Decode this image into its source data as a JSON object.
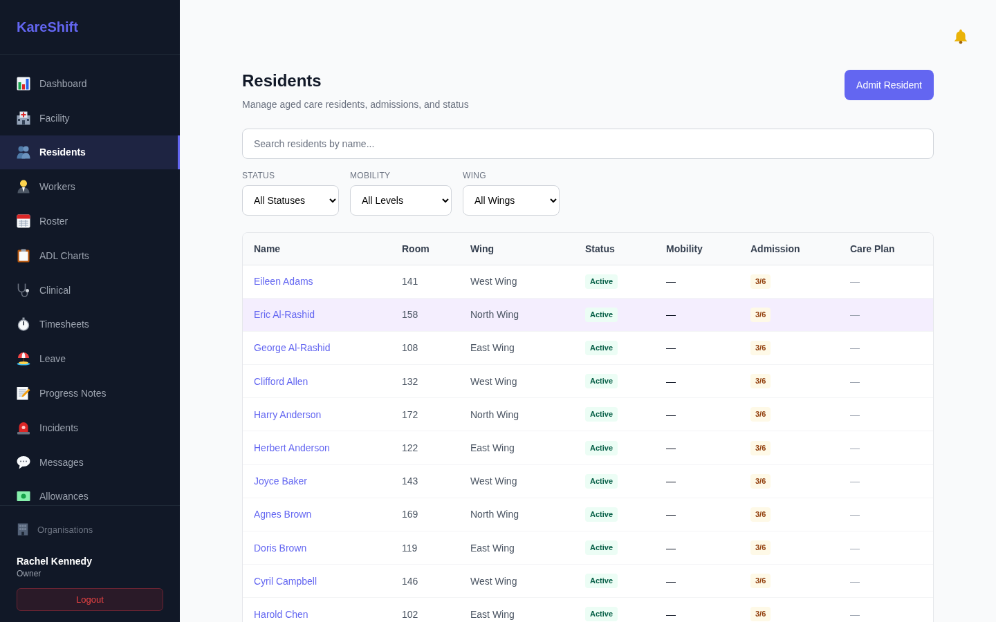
{
  "sidebar": {
    "logo": "KareShift",
    "nav_items": [
      {
        "label": "Dashboard",
        "selected": false
      },
      {
        "label": "Facility",
        "selected": false
      },
      {
        "label": "Residents",
        "selected": true
      },
      {
        "label": "Workers",
        "selected": false
      },
      {
        "label": "Roster",
        "selected": false
      },
      {
        "label": "ADL Charts",
        "selected": false
      },
      {
        "label": "Clinical",
        "selected": false
      },
      {
        "label": "Timesheets",
        "selected": false
      },
      {
        "label": "Leave",
        "selected": false
      },
      {
        "label": "Progress Notes",
        "selected": false
      },
      {
        "label": "Incidents",
        "selected": false
      },
      {
        "label": "Messages",
        "selected": false
      },
      {
        "label": "Allowances",
        "selected": false
      }
    ],
    "organisations_link": "Organisations",
    "user": {
      "name": "Rachel Kennedy",
      "role": "Owner"
    },
    "logout_button": "Logout"
  },
  "header": {
    "title": "Residents",
    "subtitle": "Manage aged care residents, admissions, and status",
    "primary_button": "Admit Resident"
  },
  "search": {
    "placeholder": "Search residents by name..."
  },
  "filters": [
    {
      "label": "STATUS",
      "value": "All Statuses"
    },
    {
      "label": "MOBILITY",
      "value": "All Levels"
    },
    {
      "label": "WING",
      "value": "All Wings"
    }
  ],
  "table": {
    "columns": [
      "Name",
      "Room",
      "Wing",
      "Status",
      "Mobility",
      "Admission",
      "Care Plan"
    ],
    "rows": [
      {
        "name": "Eileen Adams",
        "room": "141",
        "wing": "West Wing",
        "status": "Active",
        "mobility": "—",
        "admission": "3/6",
        "care_plan": "—",
        "hovered": false
      },
      {
        "name": "Eric Al-Rashid",
        "room": "158",
        "wing": "North Wing",
        "status": "Active",
        "mobility": "—",
        "admission": "3/6",
        "care_plan": "—",
        "hovered": true
      },
      {
        "name": "George Al-Rashid",
        "room": "108",
        "wing": "East Wing",
        "status": "Active",
        "mobility": "—",
        "admission": "3/6",
        "care_plan": "—",
        "hovered": false
      },
      {
        "name": "Clifford Allen",
        "room": "132",
        "wing": "West Wing",
        "status": "Active",
        "mobility": "—",
        "admission": "3/6",
        "care_plan": "—",
        "hovered": false
      },
      {
        "name": "Harry Anderson",
        "room": "172",
        "wing": "North Wing",
        "status": "Active",
        "mobility": "—",
        "admission": "3/6",
        "care_plan": "—",
        "hovered": false
      },
      {
        "name": "Herbert Anderson",
        "room": "122",
        "wing": "East Wing",
        "status": "Active",
        "mobility": "—",
        "admission": "3/6",
        "care_plan": "—",
        "hovered": false
      },
      {
        "name": "Joyce Baker",
        "room": "143",
        "wing": "West Wing",
        "status": "Active",
        "mobility": "—",
        "admission": "3/6",
        "care_plan": "—",
        "hovered": false
      },
      {
        "name": "Agnes Brown",
        "room": "169",
        "wing": "North Wing",
        "status": "Active",
        "mobility": "—",
        "admission": "3/6",
        "care_plan": "—",
        "hovered": false
      },
      {
        "name": "Doris Brown",
        "room": "119",
        "wing": "East Wing",
        "status": "Active",
        "mobility": "—",
        "admission": "3/6",
        "care_plan": "—",
        "hovered": false
      },
      {
        "name": "Cyril Campbell",
        "room": "146",
        "wing": "West Wing",
        "status": "Active",
        "mobility": "—",
        "admission": "3/6",
        "care_plan": "—",
        "hovered": false
      },
      {
        "name": "Harold Chen",
        "room": "102",
        "wing": "East Wing",
        "status": "Active",
        "mobility": "—",
        "admission": "3/6",
        "care_plan": "—",
        "hovered": false
      }
    ]
  }
}
